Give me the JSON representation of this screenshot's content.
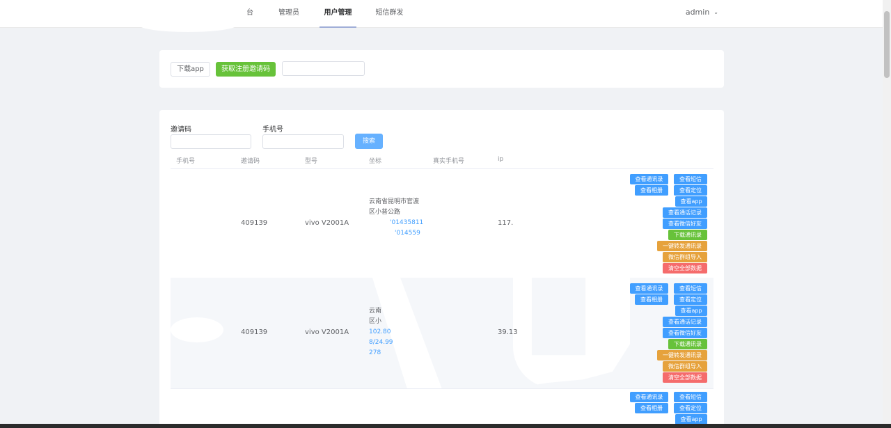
{
  "nav": {
    "items": [
      {
        "label": "台"
      },
      {
        "label": "管理员"
      },
      {
        "label": "用户管理"
      },
      {
        "label": "短信群发"
      }
    ],
    "active_index": 2,
    "user": "admin"
  },
  "toolbar": {
    "download_label": "下载app",
    "get_code_label": "获取注册邀请码",
    "code_value": ""
  },
  "search": {
    "invite_label": "邀请码",
    "phone_label": "手机号",
    "invite_value": "",
    "phone_value": "",
    "search_label": "搜索"
  },
  "table": {
    "headers": [
      "手机号",
      "邀请码",
      "型号",
      "坐标",
      "真实手机号",
      "ip"
    ],
    "rows": [
      {
        "phone": "",
        "invite": "409139",
        "model": "vivo V2001A",
        "location_lines": [
          "云南省昆明市官渡",
          "区小普公路"
        ],
        "coord_lines": [
          "'01435811",
          "'014559"
        ],
        "real_phone": "",
        "ip": "117."
      },
      {
        "phone": "",
        "invite": "409139",
        "model": "vivo V2001A",
        "location_lines": [
          "云南",
          "区小"
        ],
        "coord_lines": [
          "102.80",
          "8/24.99",
          "278"
        ],
        "real_phone": "",
        "ip": "39.13"
      }
    ],
    "actions": {
      "contacts": "查看通讯录",
      "sms": "查看短信",
      "album": "查看相册",
      "locate": "查看定位",
      "app": "查看app",
      "call_log": "查看通话记录",
      "wechat": "查看微信好友",
      "download_contacts": "下载通讯录",
      "forward_contacts": "一键转发通讯录",
      "wechat_group": "微信群组导入",
      "clear_all": "清空全部数据"
    }
  },
  "colors": {
    "primary": "#409eff",
    "success": "#67c23a",
    "warning": "#e6a23c",
    "danger": "#f56c6c",
    "background": "#f0f2f5"
  }
}
